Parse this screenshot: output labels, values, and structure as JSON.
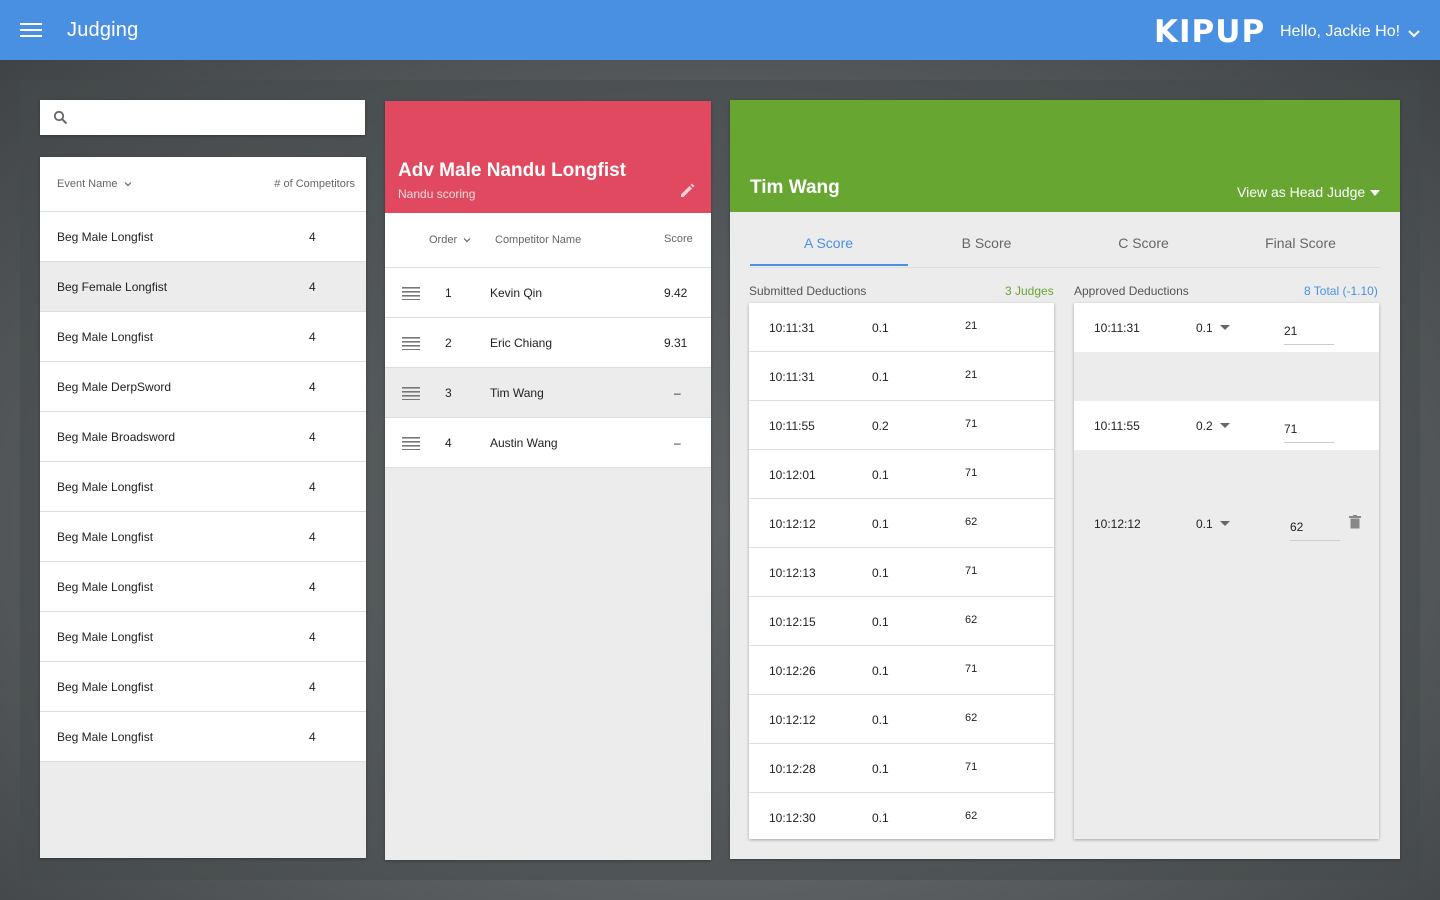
{
  "header": {
    "title": "Judging",
    "logo": "KIPUP",
    "greeting": "Hello, Jackie Ho!",
    "color": "#4a90e2"
  },
  "search": {
    "placeholder": "",
    "value": ""
  },
  "events": {
    "col_name": "Event Name",
    "col_count": "# of Competitors",
    "rows": [
      {
        "name": "Beg Male Longfist",
        "count": "4"
      },
      {
        "name": "Beg Female Longfist",
        "count": "4"
      },
      {
        "name": "Beg Male Longfist",
        "count": "4"
      },
      {
        "name": "Beg Male DerpSword",
        "count": "4"
      },
      {
        "name": "Beg Male Broadsword",
        "count": "4"
      },
      {
        "name": "Beg Male Longfist",
        "count": "4"
      },
      {
        "name": "Beg Male Longfist",
        "count": "4"
      },
      {
        "name": "Beg Male Longfist",
        "count": "4"
      },
      {
        "name": "Beg Male Longfist",
        "count": "4"
      },
      {
        "name": "Beg Male Longfist",
        "count": "4"
      },
      {
        "name": "Beg Male Longfist",
        "count": "4"
      }
    ]
  },
  "event": {
    "title": "Adv Male Nandu Longfist",
    "subtitle": "Nandu scoring",
    "color": "#e0495f",
    "col_order": "Order",
    "col_name": "Competitor Name",
    "col_score": "Score",
    "competitors": [
      {
        "order": "1",
        "name": "Kevin Qin",
        "score": "9.42"
      },
      {
        "order": "2",
        "name": "Eric Chiang",
        "score": "9.31"
      },
      {
        "order": "3",
        "name": "Tim Wang",
        "score": "–"
      },
      {
        "order": "4",
        "name": "Austin Wang",
        "score": "–"
      }
    ]
  },
  "competitor": {
    "name": "Tim Wang",
    "view_mode": "View as Head Judge",
    "color": "#67a631",
    "tabs": [
      "A Score",
      "B Score",
      "C Score",
      "Final Score"
    ],
    "submitted": {
      "label": "Submitted Deductions",
      "judges": "3 Judges",
      "rows": [
        {
          "time": "10:11:31",
          "value": "0.1",
          "code": "21"
        },
        {
          "time": "10:11:31",
          "value": "0.1",
          "code": "21"
        },
        {
          "time": "10:11:55",
          "value": "0.2",
          "code": "71"
        },
        {
          "time": "10:12:01",
          "value": "0.1",
          "code": "71"
        },
        {
          "time": "10:12:12",
          "value": "0.1",
          "code": "62"
        },
        {
          "time": "10:12:13",
          "value": "0.1",
          "code": "71"
        },
        {
          "time": "10:12:15",
          "value": "0.1",
          "code": "62"
        },
        {
          "time": "10:12:26",
          "value": "0.1",
          "code": "71"
        },
        {
          "time": "10:12:12",
          "value": "0.1",
          "code": "62"
        },
        {
          "time": "10:12:28",
          "value": "0.1",
          "code": "71"
        },
        {
          "time": "10:12:30",
          "value": "0.1",
          "code": "62"
        }
      ]
    },
    "approved": {
      "label": "Approved Deductions",
      "total": "8 Total (-1.10)",
      "rows": [
        {
          "time": "10:11:31",
          "value": "0.1",
          "code": "21"
        },
        {
          "time": "10:11:55",
          "value": "0.2",
          "code": "71"
        },
        {
          "time": "10:12:12",
          "value": "0.1",
          "code": "62"
        }
      ]
    }
  }
}
